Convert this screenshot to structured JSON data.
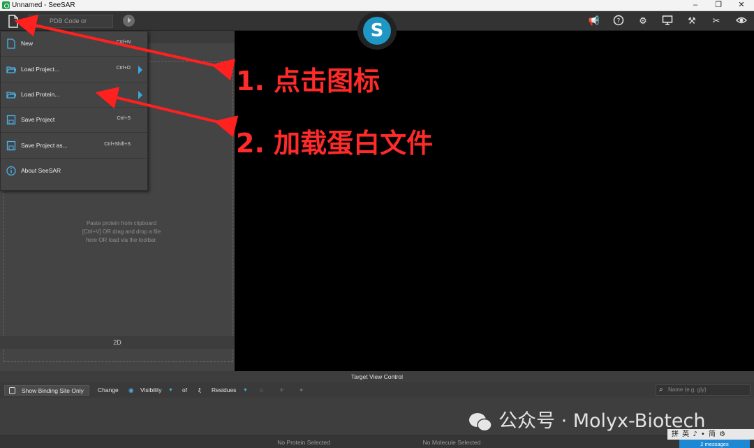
{
  "window": {
    "title": "Unnamed - SeeSAR",
    "min": "–",
    "restore": "❐",
    "close": "✕"
  },
  "toolbar": {
    "pdb_placeholder": "PDB Code or Keyword",
    "logo_letter": "S"
  },
  "menu": {
    "items": [
      {
        "label": "New",
        "shortcut": "Ctrl+N",
        "submenu": false
      },
      {
        "label": "Load Project...",
        "shortcut": "Ctrl+O",
        "submenu": true
      },
      {
        "label": "Load Protein...",
        "shortcut": "",
        "submenu": true
      },
      {
        "label": "Save Project",
        "shortcut": "Ctrl+S",
        "submenu": false
      },
      {
        "label": "Save Project as...",
        "shortcut": "Ctrl+Shift+S",
        "submenu": false
      },
      {
        "label": "About SeeSAR",
        "shortcut": "",
        "submenu": false
      }
    ]
  },
  "left_panel": {
    "drop_hint": "Paste protein from clipboard [Ctrl+V] OR drag and drop a file here OR load via the toolbar.",
    "tab_2d": "2D"
  },
  "target_view": {
    "header": "Target View Control",
    "show_binding_site": "Show Binding Site Only",
    "change": "Change",
    "visibility": "Visibility",
    "of": "of",
    "residues": "Residues",
    "name_placeholder": "Name (e.g. gly)"
  },
  "status": {
    "protein": "No Protein Selected",
    "molecule": "No Molecule Selected",
    "messages": "2 messages"
  },
  "annotations": {
    "step1": "1. 点击图标",
    "step2": "2. 加载蛋白文件"
  },
  "watermark": "公众号 · Molyx-Biotech",
  "ime_text": "拼 英 ♪ • 简 ⚙",
  "colors": {
    "accent": "#1f97c4",
    "annotation": "#ff2a2a",
    "submenu_arrow": "#3aa8e0"
  }
}
